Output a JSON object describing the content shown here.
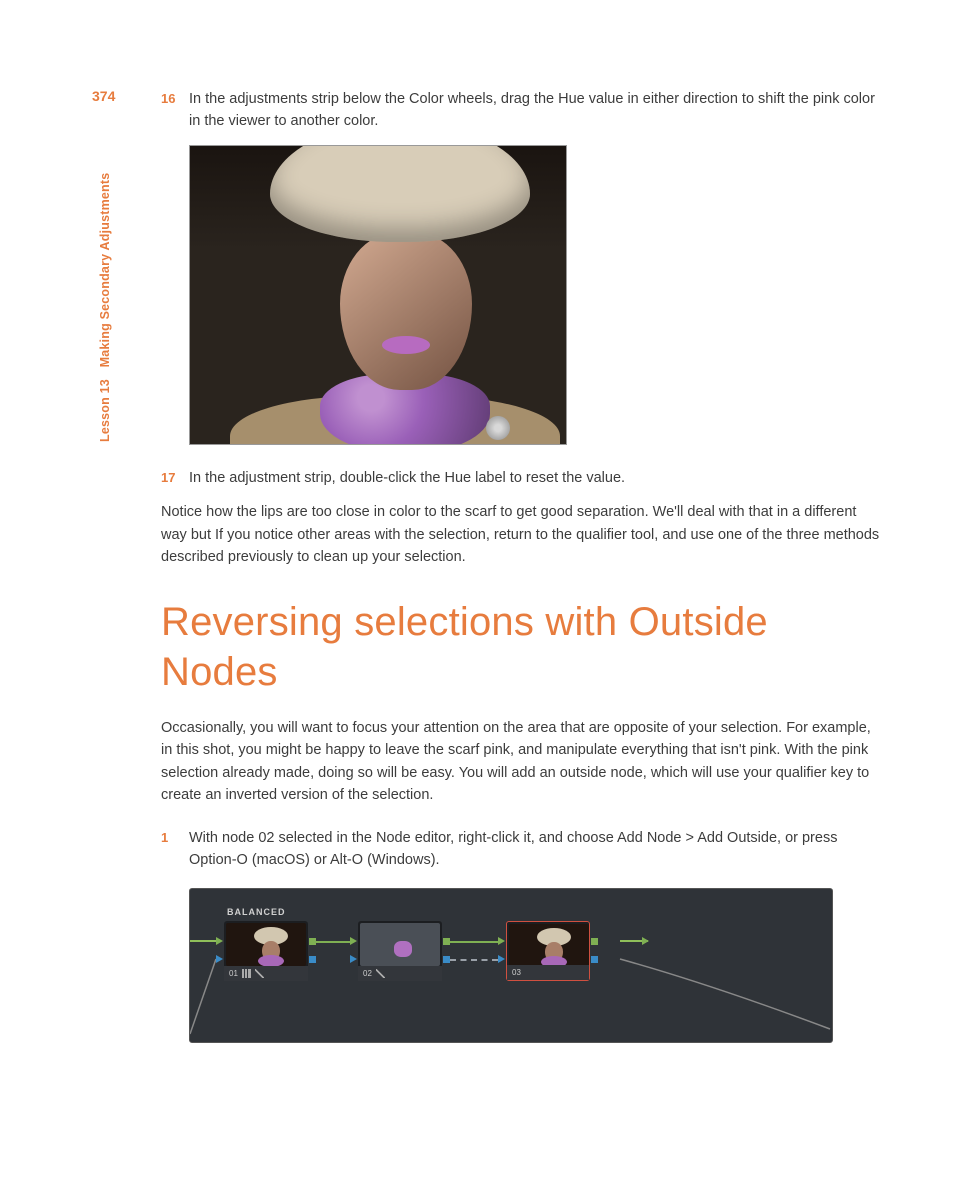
{
  "page_number": "374",
  "sidebar": {
    "lesson": "Lesson 13",
    "title": "Making Secondary Adjustments"
  },
  "steps": {
    "s16": {
      "num": "16",
      "text": "In the adjustments strip below the Color wheels, drag the Hue value in either direction to shift the pink color in the viewer to another color."
    },
    "s17": {
      "num": "17",
      "text": "In the adjustment strip, double-click the Hue label to reset the value."
    },
    "s1": {
      "num": "1",
      "text": "With node 02 selected in the Node editor, right-click it, and choose Add Node > Add Outside, or press Option-O (macOS) or Alt-O (Windows)."
    }
  },
  "paragraphs": {
    "p1": "Notice how the lips are too close in color to the scarf to get good separation. We'll deal with that in a different way but If you notice other areas with the selection, return to the qualifier tool, and use one of the three methods described previously to clean up your selection.",
    "p2": "Occasionally, you will want to focus your attention on the area that are opposite of your selection. For example, in this shot, you might be happy to leave the scarf pink, and manipulate everything that isn't pink. With the pink selection already made, doing so will be easy. You will add an outside node, which will use your qualifier key to create an inverted version of the selection."
  },
  "heading": "Reversing selections with Outside Nodes",
  "node_editor": {
    "label": "BALANCED",
    "nodes": {
      "n1": "01",
      "n2": "02",
      "n3": "03"
    }
  }
}
